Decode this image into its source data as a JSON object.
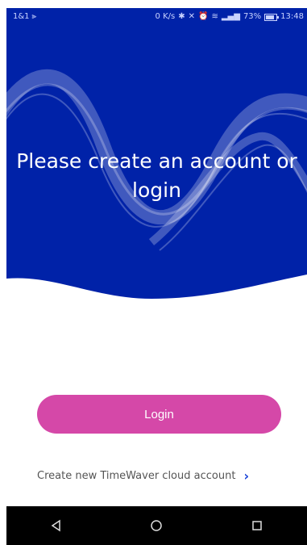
{
  "status_bar": {
    "carrier": "1&1",
    "speed": "0 K/s",
    "battery_percent": "73%",
    "time": "13:48"
  },
  "hero": {
    "headline_line1": "Please create an account or",
    "headline_line2": "login",
    "bg_color": "#0022a8"
  },
  "actions": {
    "login_label": "Login",
    "create_account_label": "Create new TimeWaver cloud account"
  },
  "nav_bar": {
    "back_icon": "back-triangle-icon",
    "home_icon": "home-circle-icon",
    "recents_icon": "recents-square-icon"
  },
  "colors": {
    "primary_blue": "#0022a8",
    "login_pink": "#d548a8",
    "link_blue": "#1a44d8"
  }
}
